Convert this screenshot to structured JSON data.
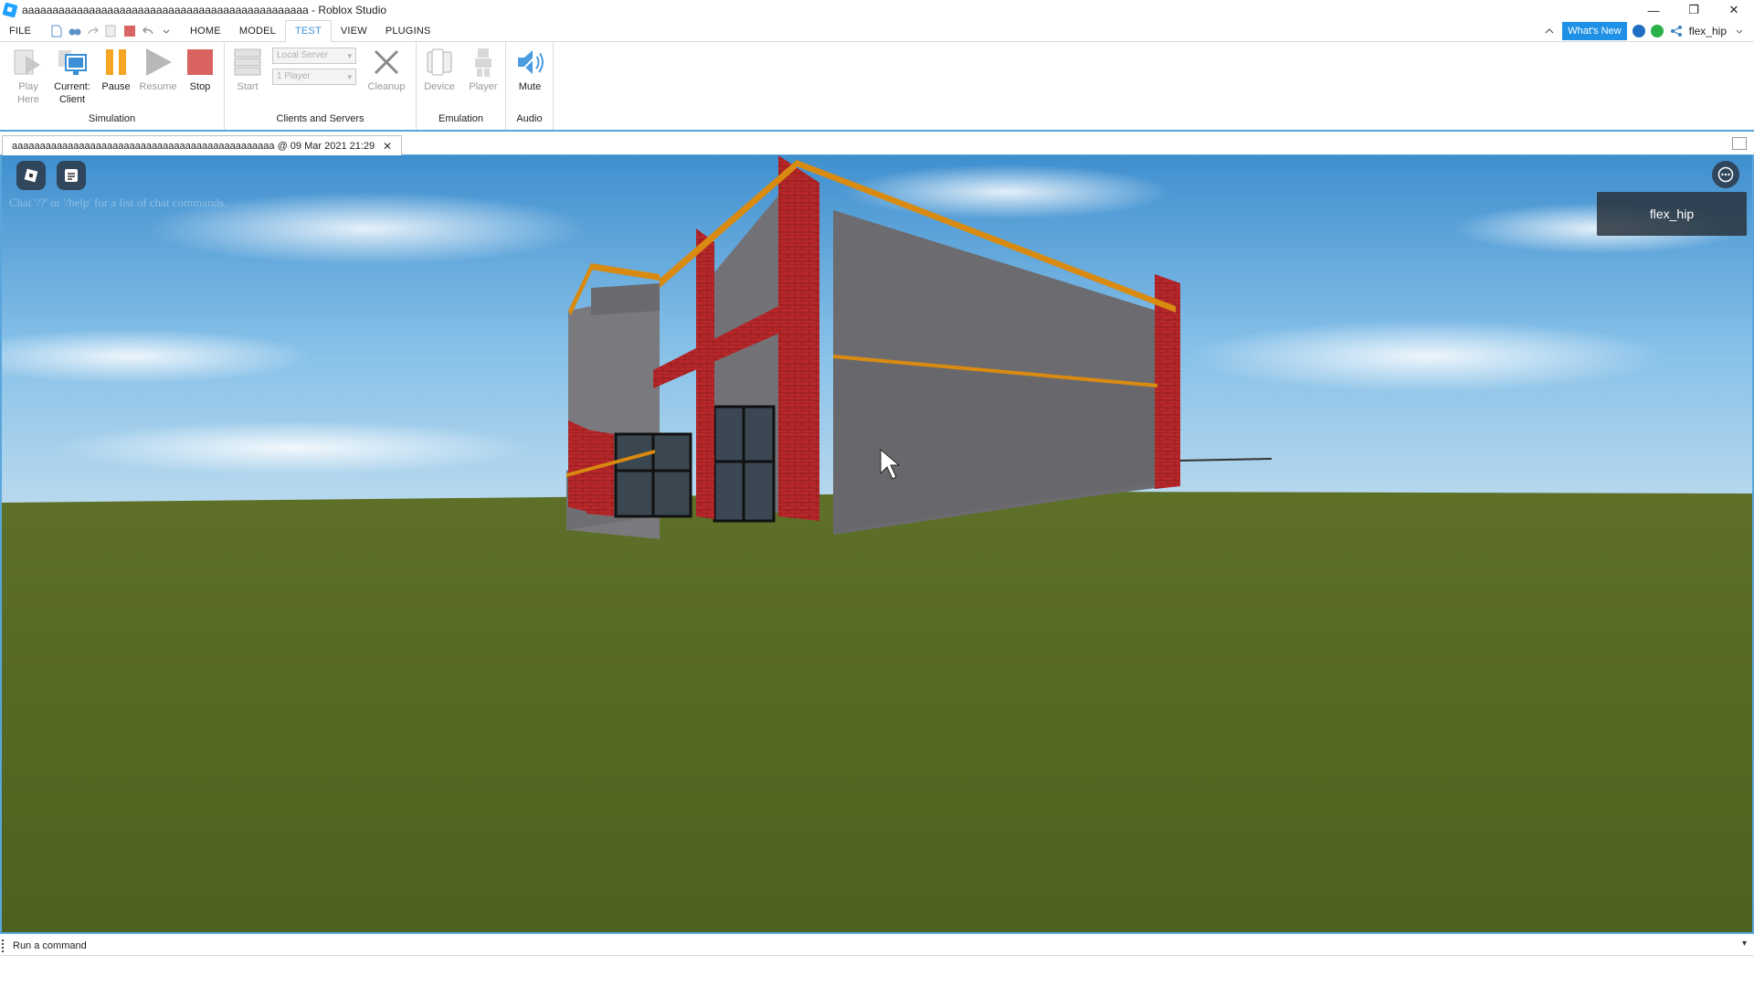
{
  "window": {
    "title": "aaaaaaaaaaaaaaaaaaaaaaaaaaaaaaaaaaaaaaaaaaaaaaa - Roblox Studio",
    "minimize": "—",
    "restore": "❐",
    "close": "✕"
  },
  "menu": {
    "file": "FILE",
    "tabs": [
      "HOME",
      "MODEL",
      "TEST",
      "VIEW",
      "PLUGINS"
    ],
    "active_tab": "TEST",
    "whats_new": "What's New",
    "user": "flex_hip"
  },
  "ribbon": {
    "simulation": {
      "label": "Simulation",
      "play_here": "Play Here",
      "current_client_line1": "Current:",
      "current_client_line2": "Client",
      "pause": "Pause",
      "resume": "Resume",
      "stop": "Stop"
    },
    "clients": {
      "label": "Clients and Servers",
      "start": "Start",
      "server_select": "Local Server",
      "player_select": "1 Player",
      "cleanup": "Cleanup"
    },
    "emulation": {
      "label": "Emulation",
      "device": "Device",
      "player": "Player"
    },
    "audio": {
      "label": "Audio",
      "mute": "Mute"
    }
  },
  "document": {
    "tab_title": "aaaaaaaaaaaaaaaaaaaaaaaaaaaaaaaaaaaaaaaaaaaaaaa @ 09 Mar 2021 21:29",
    "close": "✕"
  },
  "viewport": {
    "chat_hint": "Chat '/?' or '/help' for a list of chat commands.",
    "player_name": "flex_hip"
  },
  "command_bar": {
    "placeholder": "Run a command"
  }
}
